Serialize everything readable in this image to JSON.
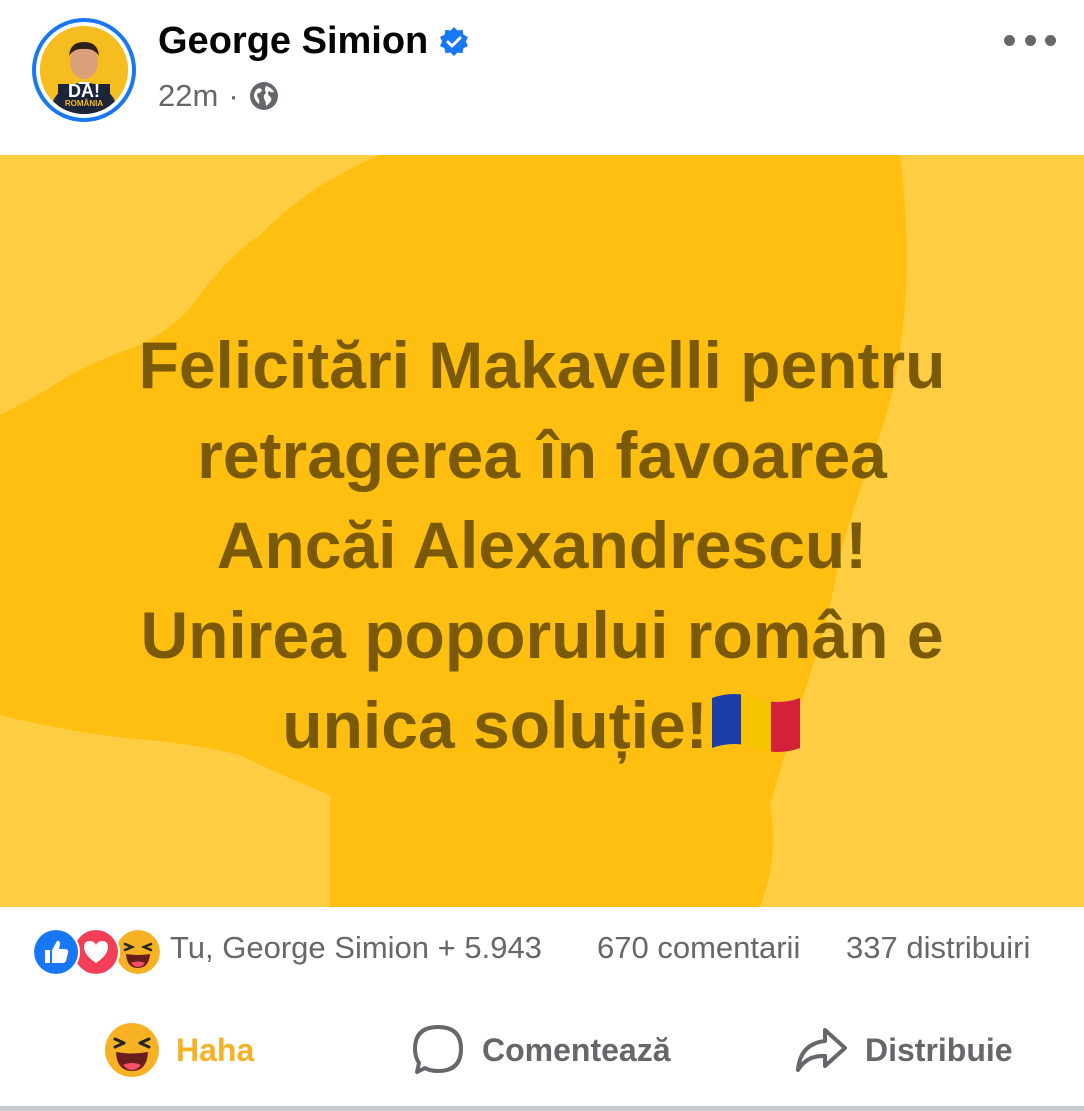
{
  "post": {
    "author": "George Simion",
    "time": "22m",
    "separator": "·",
    "avatar_text": "DA!",
    "avatar_subtext": "ROMÂNIA",
    "text_lines": [
      "Felicitări Makavelli pentru",
      "retragerea în favoarea",
      "Ancăi Alexandrescu!",
      "Unirea poporului român e",
      "unica soluție!"
    ],
    "flag_emoji": "romania-flag",
    "background_color": "#ffca3a",
    "text_color": "#7a5a06"
  },
  "icons": {
    "verified": "verified-badge-icon",
    "privacy": "globe-icon",
    "more": "more-options-icon"
  },
  "engagement": {
    "reaction_types": [
      "like",
      "love",
      "haha"
    ],
    "reaction_names": "Tu, George Simion + 5.943",
    "comments": "670 comentarii",
    "shares": "337 distribuiri"
  },
  "actions": {
    "haha_label": "Haha",
    "comment_label": "Comentează",
    "share_label": "Distribuie",
    "haha_color": "#f7b125"
  }
}
